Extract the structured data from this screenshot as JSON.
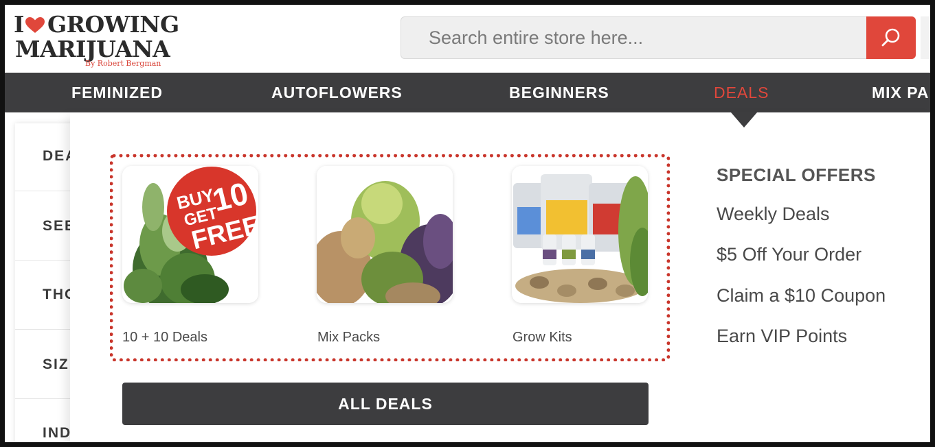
{
  "brand": {
    "logo_line1_left": "I",
    "logo_line1_right": "GROWING",
    "logo_line2": "MARIJUANA",
    "logo_byline": "By Robert Bergman",
    "heart_icon": "heart-icon",
    "accent_color": "#e0473b"
  },
  "search": {
    "placeholder": "Search entire store here...",
    "button_icon": "search-icon"
  },
  "nav": {
    "items": [
      {
        "label": "FEMINIZED"
      },
      {
        "label": "AUTOFLOWERS"
      },
      {
        "label": "BEGINNERS"
      },
      {
        "label": "DEALS",
        "active": true
      },
      {
        "label": "MIX PA"
      }
    ],
    "background_color": "#3d3d3f"
  },
  "sidebar": {
    "items": [
      {
        "label": "DEA"
      },
      {
        "label": "SEE"
      },
      {
        "label": "THO"
      },
      {
        "label": "SIZ"
      },
      {
        "label": "IND"
      }
    ]
  },
  "deals_menu": {
    "cards": [
      {
        "label": "10 + 10 Deals",
        "badge_lines": [
          "BUY",
          "10",
          "GET",
          "FREE"
        ],
        "image": "cannabis-plant-with-buy-10-get-10-free-badge"
      },
      {
        "label": "Mix Packs",
        "image": "assorted-cannabis-buds"
      },
      {
        "label": "Grow Kits",
        "image": "nutrient-bags-bottles-and-seeds"
      }
    ],
    "all_deals_label": "ALL DEALS",
    "highlight_color": "#c9362c"
  },
  "special_offers": {
    "title": "SPECIAL OFFERS",
    "links": [
      {
        "label": "Weekly Deals"
      },
      {
        "label": "$5 Off Your Order"
      },
      {
        "label": "Claim a $10 Coupon"
      },
      {
        "label": "Earn VIP Points"
      }
    ]
  }
}
